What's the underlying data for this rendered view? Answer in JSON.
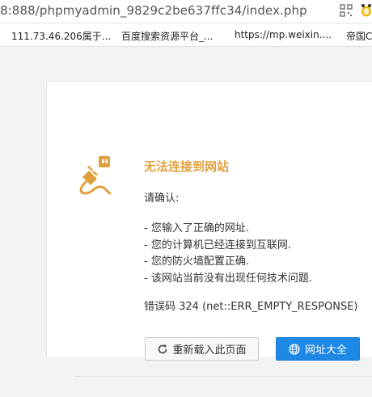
{
  "browser": {
    "url": "8:888/phpmyadmin_9829c2be637ffc34/index.php",
    "bookmarks": [
      {
        "label": "111.73.46.206属于..."
      },
      {
        "label": "百度搜索资源平台_..."
      },
      {
        "label": "https://mp.weixin...."
      },
      {
        "label": "帝国C"
      }
    ]
  },
  "error_page": {
    "title": "无法连接到网站",
    "confirm_heading": "请确认:",
    "checks": [
      "- 您输入了正确的网址.",
      "- 您的计算机已经连接到互联网.",
      "- 您的防火墙配置正确.",
      "- 该网站当前没有出现任何技术问题."
    ],
    "error_code": "错误码 324 (net::ERR_EMPTY_RESPONSE)",
    "reload_button": "重新载入此页面",
    "nav_button": "网址大全"
  },
  "colors": {
    "accent_orange": "#e0a13c",
    "button_blue": "#1e88e5"
  },
  "icons": [
    "qr-code-icon",
    "extension-icon",
    "plug-icon",
    "refresh-icon",
    "globe-icon"
  ]
}
